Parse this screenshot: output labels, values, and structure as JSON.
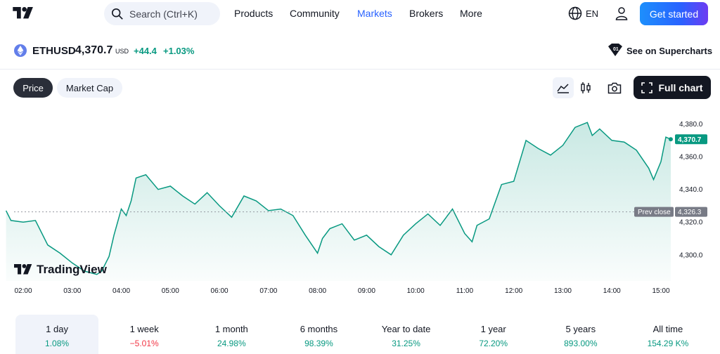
{
  "nav": {
    "search_placeholder": "Search (Ctrl+K)",
    "items": [
      "Products",
      "Community",
      "Markets",
      "Brokers",
      "More"
    ],
    "active": "Markets",
    "language": "EN",
    "cta": "Get started"
  },
  "symbol": {
    "ticker": "ETHUSD",
    "price": "4,370.7",
    "currency": "USD",
    "change": "+44.4",
    "change_pct": "+1.03%",
    "supercharts_label": "See on Supercharts"
  },
  "toolbar": {
    "tabs": [
      "Price",
      "Market Cap"
    ],
    "active_tab": "Price",
    "full_chart_label": "Full chart"
  },
  "watermark": "TradingView",
  "colors": {
    "line": "#089981",
    "positive": "#089981",
    "negative": "#f23645",
    "accent": "#2962ff"
  },
  "chart_data": {
    "type": "area",
    "x_ticks": [
      "02:00",
      "03:00",
      "04:00",
      "05:00",
      "06:00",
      "07:00",
      "08:00",
      "09:00",
      "10:00",
      "11:00",
      "12:00",
      "13:00",
      "14:00",
      "15:00"
    ],
    "y_ticks": [
      4300,
      4320,
      4340,
      4360,
      4380
    ],
    "y_tick_labels": [
      "4,300.0",
      "4,320.0",
      "4,340.0",
      "4,360.0",
      "4,380.0"
    ],
    "ylim": [
      4284,
      4388
    ],
    "last_price_label": "4,370.7",
    "prev_close": 4326.3,
    "prev_close_label": "4,326.3",
    "prev_close_text": "Prev close",
    "x": [
      1.65,
      1.75,
      2.0,
      2.25,
      2.5,
      2.75,
      3.0,
      3.25,
      3.5,
      3.6,
      3.75,
      3.85,
      4.0,
      4.1,
      4.2,
      4.3,
      4.5,
      4.75,
      5.0,
      5.25,
      5.5,
      5.75,
      6.0,
      6.25,
      6.5,
      6.75,
      7.0,
      7.25,
      7.5,
      7.75,
      8.0,
      8.1,
      8.25,
      8.5,
      8.75,
      9.0,
      9.25,
      9.5,
      9.75,
      10.0,
      10.25,
      10.5,
      10.75,
      11.0,
      11.15,
      11.25,
      11.5,
      11.75,
      12.0,
      12.25,
      12.5,
      12.75,
      13.0,
      13.25,
      13.5,
      13.6,
      13.75,
      14.0,
      14.25,
      14.5,
      14.75,
      14.85,
      15.0,
      15.1,
      15.2
    ],
    "y": [
      4327,
      4321,
      4320,
      4321,
      4306,
      4301,
      4295,
      4290,
      4288,
      4290,
      4299,
      4312,
      4328,
      4324,
      4333,
      4347,
      4349,
      4340,
      4342,
      4336,
      4331,
      4338,
      4330,
      4323,
      4336,
      4333,
      4327,
      4328,
      4324,
      4312,
      4301,
      4310,
      4316,
      4319,
      4309,
      4312,
      4305,
      4300,
      4312,
      4319,
      4325,
      4318,
      4328,
      4313,
      4308,
      4318,
      4322,
      4343,
      4345,
      4370,
      4365,
      4361,
      4367,
      4378,
      4381,
      4373,
      4377,
      4370,
      4369,
      4364,
      4353,
      4346,
      4357,
      4372,
      4370.7
    ]
  },
  "periods": [
    {
      "label": "1 day",
      "value": "1.08%",
      "trend": "pos"
    },
    {
      "label": "1 week",
      "value": "−5.01%",
      "trend": "neg"
    },
    {
      "label": "1 month",
      "value": "24.98%",
      "trend": "pos"
    },
    {
      "label": "6 months",
      "value": "98.39%",
      "trend": "pos"
    },
    {
      "label": "Year to date",
      "value": "31.25%",
      "trend": "pos"
    },
    {
      "label": "1 year",
      "value": "72.20%",
      "trend": "pos"
    },
    {
      "label": "5 years",
      "value": "893.00%",
      "trend": "pos"
    },
    {
      "label": "All time",
      "value": "154.29 K%",
      "trend": "pos"
    }
  ],
  "active_period": "1 day"
}
